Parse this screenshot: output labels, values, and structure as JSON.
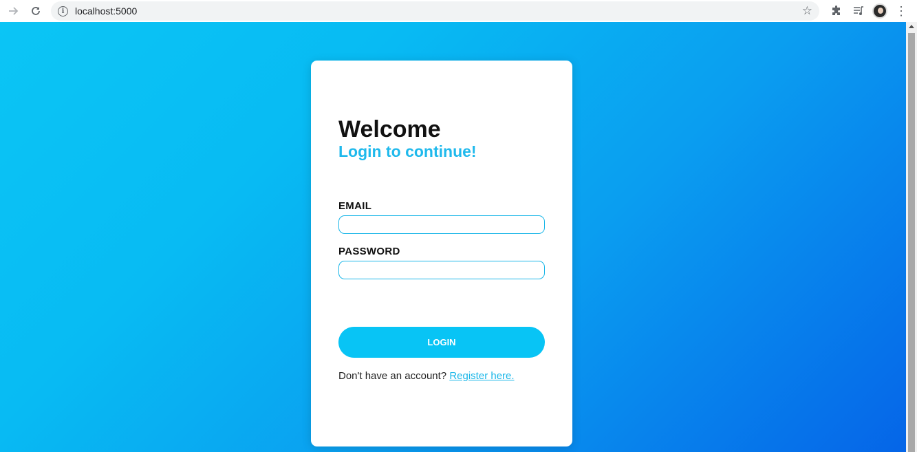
{
  "browser": {
    "url": "localhost:5000",
    "icons": [
      "forward-arrow-icon",
      "reload-icon",
      "info-icon",
      "star-icon",
      "extensions-icon",
      "media-queue-icon",
      "avatar",
      "menu-icon"
    ]
  },
  "login": {
    "title": "Welcome",
    "subtitle": "Login to continue!",
    "email_label": "EMAIL",
    "email_value": "",
    "password_label": "PASSWORD",
    "password_value": "",
    "login_button": "LOGIN",
    "register_prompt": "Don't have an account?",
    "register_link": "Register here."
  },
  "colors": {
    "accent": "#08c4f5",
    "gradient_start": "#0bc5f5",
    "gradient_end": "#0565e8",
    "card": "#ffffff"
  }
}
